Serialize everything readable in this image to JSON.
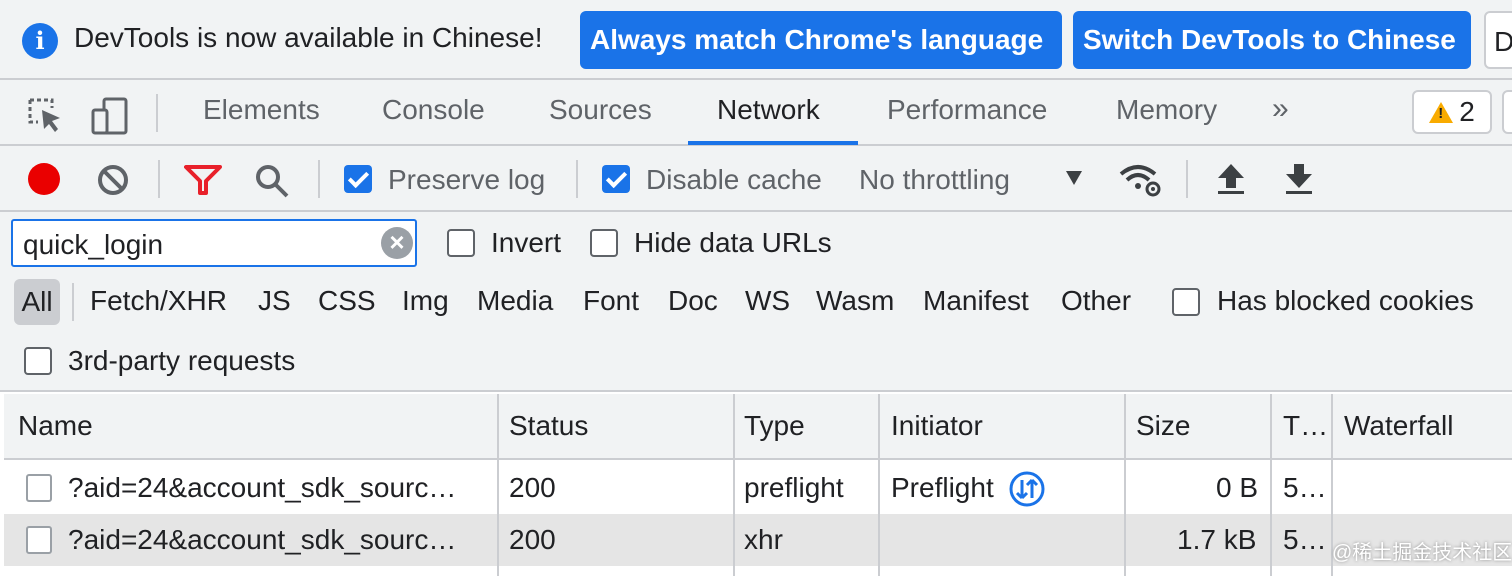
{
  "infobar": {
    "message": "DevTools is now available in Chinese!",
    "match_language_label": "Always match Chrome's language",
    "switch_label": "Switch DevTools to Chinese",
    "dismiss_fragment": "D"
  },
  "tabs": {
    "items": [
      {
        "label": "Elements"
      },
      {
        "label": "Console"
      },
      {
        "label": "Sources"
      },
      {
        "label": "Network"
      },
      {
        "label": "Performance"
      },
      {
        "label": "Memory"
      }
    ],
    "active": "Network",
    "more_label": "»",
    "warnings_count": "2"
  },
  "toolbar": {
    "preserve_log_label": "Preserve log",
    "preserve_log_checked": true,
    "disable_cache_label": "Disable cache",
    "disable_cache_checked": true,
    "throttling_value": "No throttling"
  },
  "filter": {
    "search_value": "quick_login",
    "invert_label": "Invert",
    "hide_data_urls_label": "Hide data URLs",
    "types": [
      "All",
      "Fetch/XHR",
      "JS",
      "CSS",
      "Img",
      "Media",
      "Font",
      "Doc",
      "WS",
      "Wasm",
      "Manifest",
      "Other"
    ],
    "active_type": "All",
    "blocked_cookies_label": "Has blocked cookies",
    "third_party_label": "3rd-party requests"
  },
  "table": {
    "columns": [
      "Name",
      "Status",
      "Type",
      "Initiator",
      "Size",
      "T…",
      "Waterfall"
    ],
    "rows": [
      {
        "name": "?aid=24&account_sdk_sourc…",
        "status": "200",
        "type": "preflight",
        "initiator": "Preflight",
        "size": "0 B",
        "time": "5…"
      },
      {
        "name": "?aid=24&account_sdk_sourc…",
        "status": "200",
        "type": "xhr",
        "initiator": "",
        "size": "1.7 kB",
        "time": "5…"
      }
    ]
  },
  "watermark": "@稀土掘金技术社区",
  "colors": {
    "accent": "#1a73e8",
    "record": "#ea0000",
    "filter_icon": "#e8202a",
    "warning": "#f9ab00"
  }
}
